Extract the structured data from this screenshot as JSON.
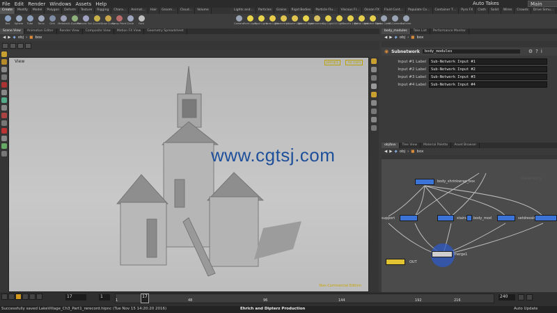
{
  "menu": [
    "File",
    "Edit",
    "Render",
    "Windows",
    "Assets",
    "Help"
  ],
  "top_right": {
    "auto_takes": "Auto Takes",
    "desktop": "Main"
  },
  "shelf_left": {
    "tabs": [
      "Create",
      "Modify",
      "Model",
      "Polygon",
      "Deform",
      "Texture",
      "Rigging",
      "Chara…",
      "Animat…",
      "Hair",
      "Groom…",
      "Cloud…",
      "Volume"
    ],
    "tools": [
      {
        "label": "Box",
        "color": "#8aa0c0"
      },
      {
        "label": "Sphere",
        "color": "#9aa9c0"
      },
      {
        "label": "Tube",
        "color": "#8e9fbc"
      },
      {
        "label": "Torus",
        "color": "#a0a8bb"
      },
      {
        "label": "Grid",
        "color": "#7f8da6"
      },
      {
        "label": "Metaball",
        "color": "#9a9fb5"
      },
      {
        "label": "L-System",
        "color": "#8fb07a"
      },
      {
        "label": "Platonic Sol…",
        "color": "#a2a2c2"
      },
      {
        "label": "Curve",
        "color": "#c9b24a"
      },
      {
        "label": "Draw Curve",
        "color": "#c9a74a"
      },
      {
        "label": "Spray Paint",
        "color": "#b96a6a"
      },
      {
        "label": "Circle",
        "color": "#9fa8c0"
      },
      {
        "label": "Font",
        "color": "#c0c0c0"
      }
    ]
  },
  "shelf_right": {
    "tabs": [
      "Lights and…",
      "Particles",
      "Grains",
      "Rigid Bodies",
      "Particle Flu…",
      "Viscous Fl…",
      "Ocean FX",
      "Fluid Cont…",
      "Populate Co…",
      "Container T…",
      "Pyro FX",
      "Cloth",
      "Solid",
      "Wires",
      "Crowds",
      "Drive Simu…"
    ],
    "tools": [
      {
        "label": "Camera",
        "color": "#9aa4b4"
      },
      {
        "label": "Point Light",
        "color": "#e8d44a"
      },
      {
        "label": "Spot Light",
        "color": "#e8d44a"
      },
      {
        "label": "Area Light",
        "color": "#e8cc4a"
      },
      {
        "label": "Geometry L…",
        "color": "#e0c650"
      },
      {
        "label": "Volume Light",
        "color": "#e0c650"
      },
      {
        "label": "Distant Light",
        "color": "#e8d44a"
      },
      {
        "label": "Environmen…",
        "color": "#d8c060"
      },
      {
        "label": "Sky Light",
        "color": "#e6cf4d"
      },
      {
        "label": "GI Light",
        "color": "#e6cf4d"
      },
      {
        "label": "Caustic Light",
        "color": "#e6cf4d"
      },
      {
        "label": "Portal Light",
        "color": "#e6cf4d"
      },
      {
        "label": "Ambient Light",
        "color": "#e6cf4d"
      },
      {
        "label": "Stereo Cam…",
        "color": "#9aa4b4"
      },
      {
        "label": "VR Camera",
        "color": "#9aa4b4"
      },
      {
        "label": "Switcher",
        "color": "#9aa4b4"
      }
    ]
  },
  "viewer": {
    "tabs": [
      "Scene View",
      "Animation Editor",
      "Render View",
      "Composite View",
      "Motion FX View",
      "Geometry Spreadsheet"
    ],
    "path": [
      "obj",
      "box"
    ],
    "view_label": "View",
    "persp": "persp1",
    "camera": "no cam",
    "watermark": "www.cgtsj.com",
    "non_commercial": "Non-Commercial Edition"
  },
  "params": {
    "tabs": [
      "body_modules",
      "Take List",
      "Performance Monitor"
    ],
    "path": [
      "obj",
      "box"
    ],
    "type": "Subnetwork",
    "name": "body_modules",
    "rows": [
      {
        "label": "Input #1 Label",
        "value": "Sub-Network Input #1"
      },
      {
        "label": "Input #2 Label",
        "value": "Sub-Network Input #2"
      },
      {
        "label": "Input #3 Label",
        "value": "Sub-Network Input #3"
      },
      {
        "label": "Input #4 Label",
        "value": "Sub-Network Input #4"
      }
    ]
  },
  "network": {
    "tabs": [
      "obj/box",
      "Tree View",
      "Material Palette",
      "Asset Browser"
    ],
    "path": [
      "obj",
      "box"
    ],
    "nodes": {
      "top": "body_shrinkwrap_box",
      "support": "support",
      "stairs": "stairs",
      "body_mod": "body_mod",
      "setdressing": "setdressing",
      "merge": "merge1",
      "out": "OUT"
    },
    "geometry_label": "Geometry"
  },
  "timeline": {
    "frame": "17",
    "step": "1",
    "ticks": [
      "1",
      "17",
      "48",
      "96",
      "144",
      "192",
      "216"
    ],
    "end": "240",
    "auto_update": "Auto Update"
  },
  "status": {
    "message": "Successfully saved LakeVillage_Ch3_Part1_rerecord.hipnc (Tue Nov 15 14:20:20 2016)",
    "credit": "Ehrich   and   Dipterz  Production"
  }
}
